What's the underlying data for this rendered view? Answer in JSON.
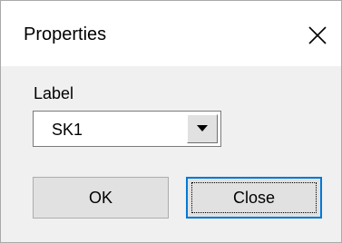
{
  "window": {
    "title": "Properties",
    "close_icon": "close-icon"
  },
  "form": {
    "label_text": "Label",
    "label_combo": {
      "selected_value": "SK1",
      "dropdown_icon": "dropdown-arrow-icon"
    }
  },
  "buttons": {
    "ok_label": "OK",
    "close_label": "Close"
  },
  "colors": {
    "focus_border": "#0078d7",
    "dialog_bg": "#f0f0f0",
    "titlebar_bg": "#ffffff"
  }
}
